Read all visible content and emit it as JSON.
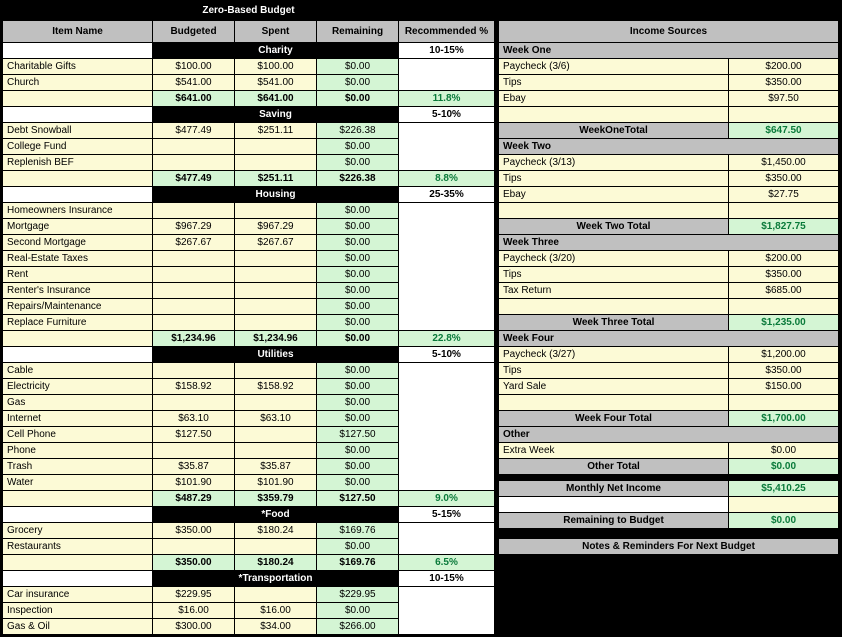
{
  "main_title": "Zero-Based Budget",
  "left": {
    "headers": {
      "item": "Item Name",
      "budgeted": "Budgeted",
      "spent": "Spent",
      "remaining": "Remaining",
      "rec": "Recommended %"
    },
    "sections": [
      {
        "title": "Charity",
        "rec_range": "10-15%",
        "rows": [
          {
            "name": "Charitable Gifts",
            "b": "$100.00",
            "s": "$100.00",
            "r": "$0.00"
          },
          {
            "name": "Church",
            "b": "$541.00",
            "s": "$541.00",
            "r": "$0.00"
          }
        ],
        "total": {
          "b": "$641.00",
          "s": "$641.00",
          "r": "$0.00",
          "p": "11.8%"
        }
      },
      {
        "title": "Saving",
        "rec_range": "5-10%",
        "rows": [
          {
            "name": "Debt Snowball",
            "b": "$477.49",
            "s": "$251.11",
            "r": "$226.38"
          },
          {
            "name": "College Fund",
            "b": "",
            "s": "",
            "r": "$0.00"
          },
          {
            "name": "Replenish BEF",
            "b": "",
            "s": "",
            "r": "$0.00"
          }
        ],
        "total": {
          "b": "$477.49",
          "s": "$251.11",
          "r": "$226.38",
          "p": "8.8%"
        }
      },
      {
        "title": "Housing",
        "rec_range": "25-35%",
        "rows": [
          {
            "name": "Homeowners Insurance",
            "b": "",
            "s": "",
            "r": "$0.00"
          },
          {
            "name": "Mortgage",
            "b": "$967.29",
            "s": "$967.29",
            "r": "$0.00"
          },
          {
            "name": "Second Mortgage",
            "b": "$267.67",
            "s": "$267.67",
            "r": "$0.00"
          },
          {
            "name": "Real-Estate Taxes",
            "b": "",
            "s": "",
            "r": "$0.00"
          },
          {
            "name": "Rent",
            "b": "",
            "s": "",
            "r": "$0.00"
          },
          {
            "name": "Renter's Insurance",
            "b": "",
            "s": "",
            "r": "$0.00"
          },
          {
            "name": "Repairs/Maintenance",
            "b": "",
            "s": "",
            "r": "$0.00"
          },
          {
            "name": "Replace Furniture",
            "b": "",
            "s": "",
            "r": "$0.00"
          }
        ],
        "total": {
          "b": "$1,234.96",
          "s": "$1,234.96",
          "r": "$0.00",
          "p": "22.8%"
        }
      },
      {
        "title": "Utilities",
        "rec_range": "5-10%",
        "rows": [
          {
            "name": "Cable",
            "b": "",
            "s": "",
            "r": "$0.00"
          },
          {
            "name": "Electricity",
            "b": "$158.92",
            "s": "$158.92",
            "r": "$0.00"
          },
          {
            "name": "Gas",
            "b": "",
            "s": "",
            "r": "$0.00"
          },
          {
            "name": "Internet",
            "b": "$63.10",
            "s": "$63.10",
            "r": "$0.00"
          },
          {
            "name": "Cell Phone",
            "b": "$127.50",
            "s": "",
            "r": "$127.50"
          },
          {
            "name": "Phone",
            "b": "",
            "s": "",
            "r": "$0.00"
          },
          {
            "name": "Trash",
            "b": "$35.87",
            "s": "$35.87",
            "r": "$0.00"
          },
          {
            "name": "Water",
            "b": "$101.90",
            "s": "$101.90",
            "r": "$0.00"
          }
        ],
        "total": {
          "b": "$487.29",
          "s": "$359.79",
          "r": "$127.50",
          "p": "9.0%"
        }
      },
      {
        "title": "*Food",
        "rec_range": "5-15%",
        "rows": [
          {
            "name": "Grocery",
            "b": "$350.00",
            "s": "$180.24",
            "r": "$169.76"
          },
          {
            "name": "Restaurants",
            "b": "",
            "s": "",
            "r": "$0.00"
          }
        ],
        "total": {
          "b": "$350.00",
          "s": "$180.24",
          "r": "$169.76",
          "p": "6.5%"
        }
      },
      {
        "title": "*Transportation",
        "rec_range": "10-15%",
        "rows": [
          {
            "name": "Car insurance",
            "b": "$229.95",
            "s": "",
            "r": "$229.95"
          },
          {
            "name": "Inspection",
            "b": "$16.00",
            "s": "$16.00",
            "r": "$0.00"
          },
          {
            "name": "Gas & Oil",
            "b": "$300.00",
            "s": "$34.00",
            "r": "$266.00"
          }
        ]
      }
    ]
  },
  "right": {
    "title": "Income Sources",
    "weeks": [
      {
        "label": "Week One",
        "rows": [
          {
            "name": "Paycheck (3/6)",
            "v": "$200.00"
          },
          {
            "name": "Tips",
            "v": "$350.00"
          },
          {
            "name": "Ebay",
            "v": "$97.50"
          },
          {
            "name": "",
            "v": ""
          }
        ],
        "total_label": "WeekOneTotal",
        "total": "$647.50"
      },
      {
        "label": "Week Two",
        "rows": [
          {
            "name": "Paycheck (3/13)",
            "v": "$1,450.00"
          },
          {
            "name": "Tips",
            "v": "$350.00"
          },
          {
            "name": "Ebay",
            "v": "$27.75"
          },
          {
            "name": "",
            "v": ""
          }
        ],
        "total_label": "Week Two Total",
        "total": "$1,827.75"
      },
      {
        "label": "Week Three",
        "rows": [
          {
            "name": "Paycheck (3/20)",
            "v": "$200.00"
          },
          {
            "name": "Tips",
            "v": "$350.00"
          },
          {
            "name": "Tax Return",
            "v": "$685.00"
          },
          {
            "name": "",
            "v": ""
          }
        ],
        "total_label": "Week Three Total",
        "total": "$1,235.00"
      },
      {
        "label": "Week Four",
        "rows": [
          {
            "name": "Paycheck (3/27)",
            "v": "$1,200.00"
          },
          {
            "name": "Tips",
            "v": "$350.00"
          },
          {
            "name": "Yard Sale",
            "v": "$150.00"
          },
          {
            "name": "",
            "v": ""
          }
        ],
        "total_label": "Week Four Total",
        "total": "$1,700.00"
      }
    ],
    "other_label": "Other",
    "other_rows": [
      {
        "name": "Extra Week",
        "v": "$0.00"
      }
    ],
    "other_total_label": "Other Total",
    "other_total": "$0.00",
    "net_label": "Monthly Net Income",
    "net": "$5,410.25",
    "remain_label": "Remaining to Budget",
    "remain": "$0.00",
    "notes_title": "Notes & Reminders For Next Budget"
  }
}
